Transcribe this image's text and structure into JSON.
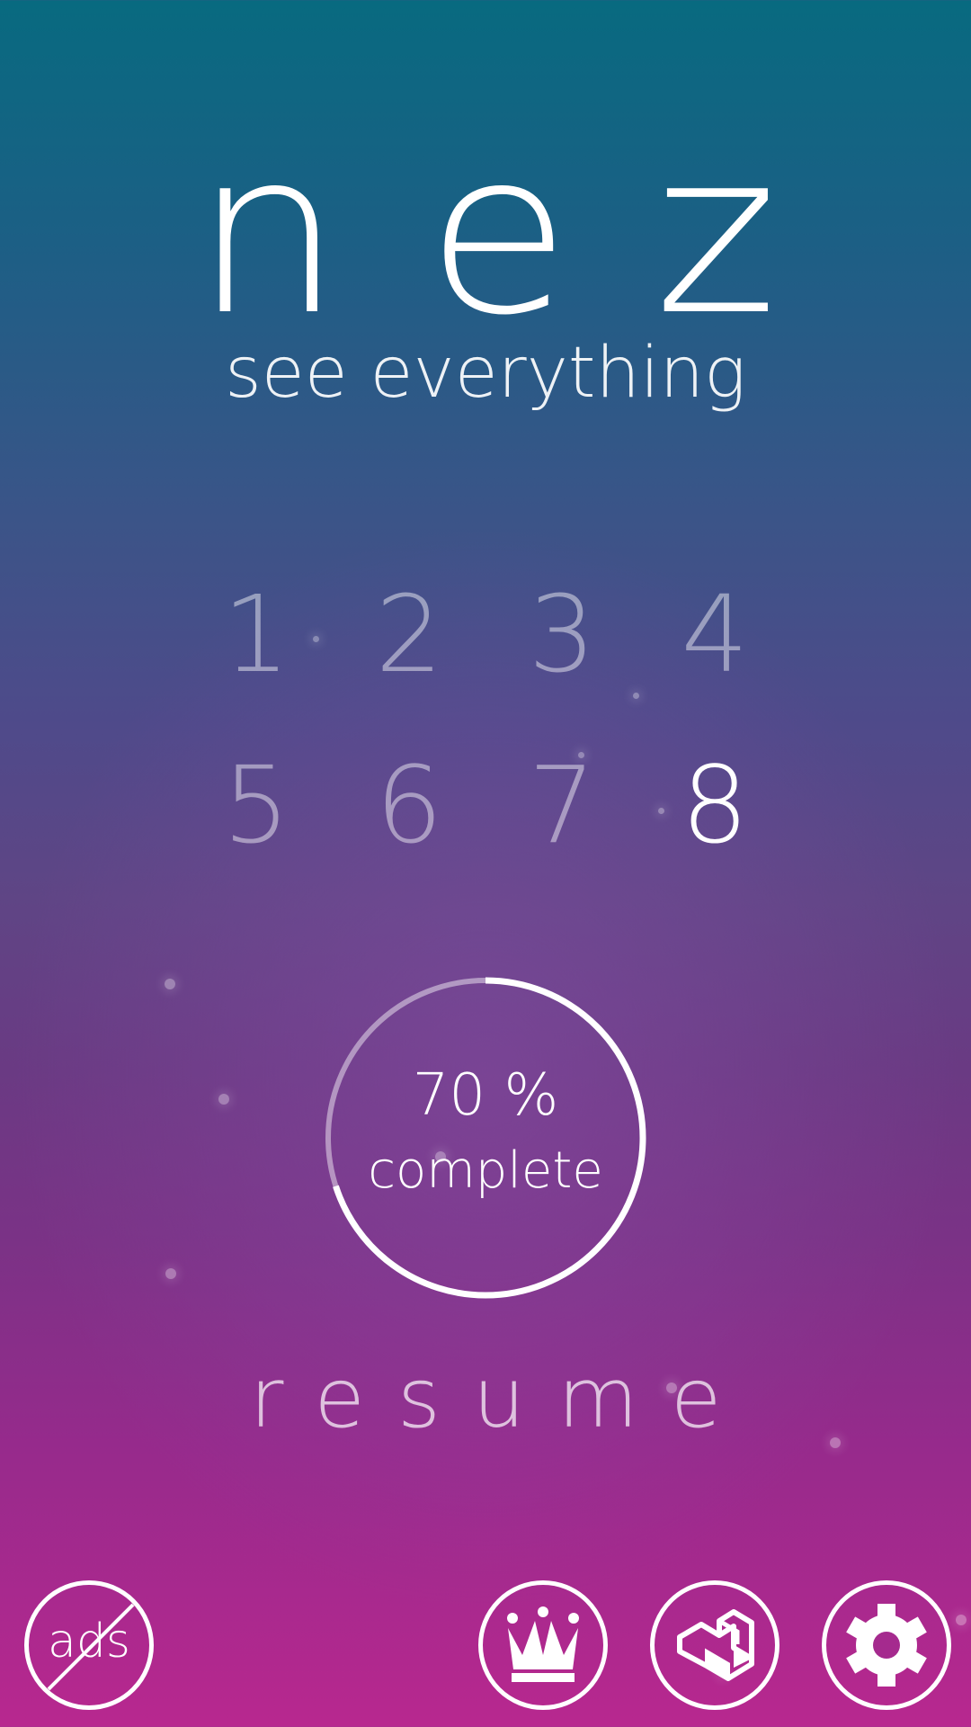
{
  "app": {
    "title": "nez",
    "tagline": "see everything"
  },
  "levels": {
    "items": [
      "1",
      "2",
      "3",
      "4",
      "5",
      "6",
      "7",
      "8"
    ],
    "active_index": 7
  },
  "progress": {
    "percent_text": "70 %",
    "label": "complete",
    "fraction": 0.7
  },
  "actions": {
    "resume_label": "resume"
  },
  "bottom_bar": {
    "ads_label": "ads",
    "icons": [
      "no-ads-icon",
      "crown-icon",
      "isometric-block-icon",
      "gear-icon"
    ]
  },
  "colors": {
    "bg_top": "#086a80",
    "bg_mid": "#5f4585",
    "bg_bottom": "#b8288f",
    "text": "#ffffff"
  }
}
